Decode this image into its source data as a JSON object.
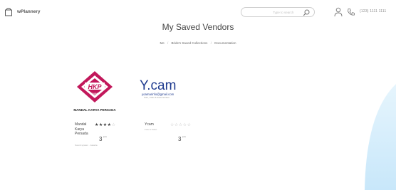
{
  "app": {
    "name": "wPlannery"
  },
  "header": {
    "search_placeholder": "Type to search",
    "phone_number": "(123) 1111 1111"
  },
  "page": {
    "title": "My Saved Vendors",
    "breadcrumb": [
      "Me",
      "Bride's Saved Collections",
      "Documentation"
    ]
  },
  "vendors": [
    {
      "name": "Mandal Karya Persada",
      "logo_text": "HKP",
      "logo_subtext": "SOUND",
      "logo_caption": "MANDAL KARYA PERSADA",
      "rating": 4,
      "price": "3",
      "price_unit": "juta",
      "subtitle": "Sound system · Jakarta"
    },
    {
      "name": "Ycam",
      "logo_text": "Y.cam",
      "logo_email": "yoamarinfo@gmail.com",
      "logo_tagline": "Foto, video & dokumentasi",
      "rating": 0,
      "price": "3",
      "price_unit": "juta",
      "subtitle": "Foto & Video"
    }
  ],
  "colors": {
    "accent_pink": "#c2185b",
    "ycam_blue": "#1f3b8f",
    "curve_blue": "#d3ecfb"
  }
}
